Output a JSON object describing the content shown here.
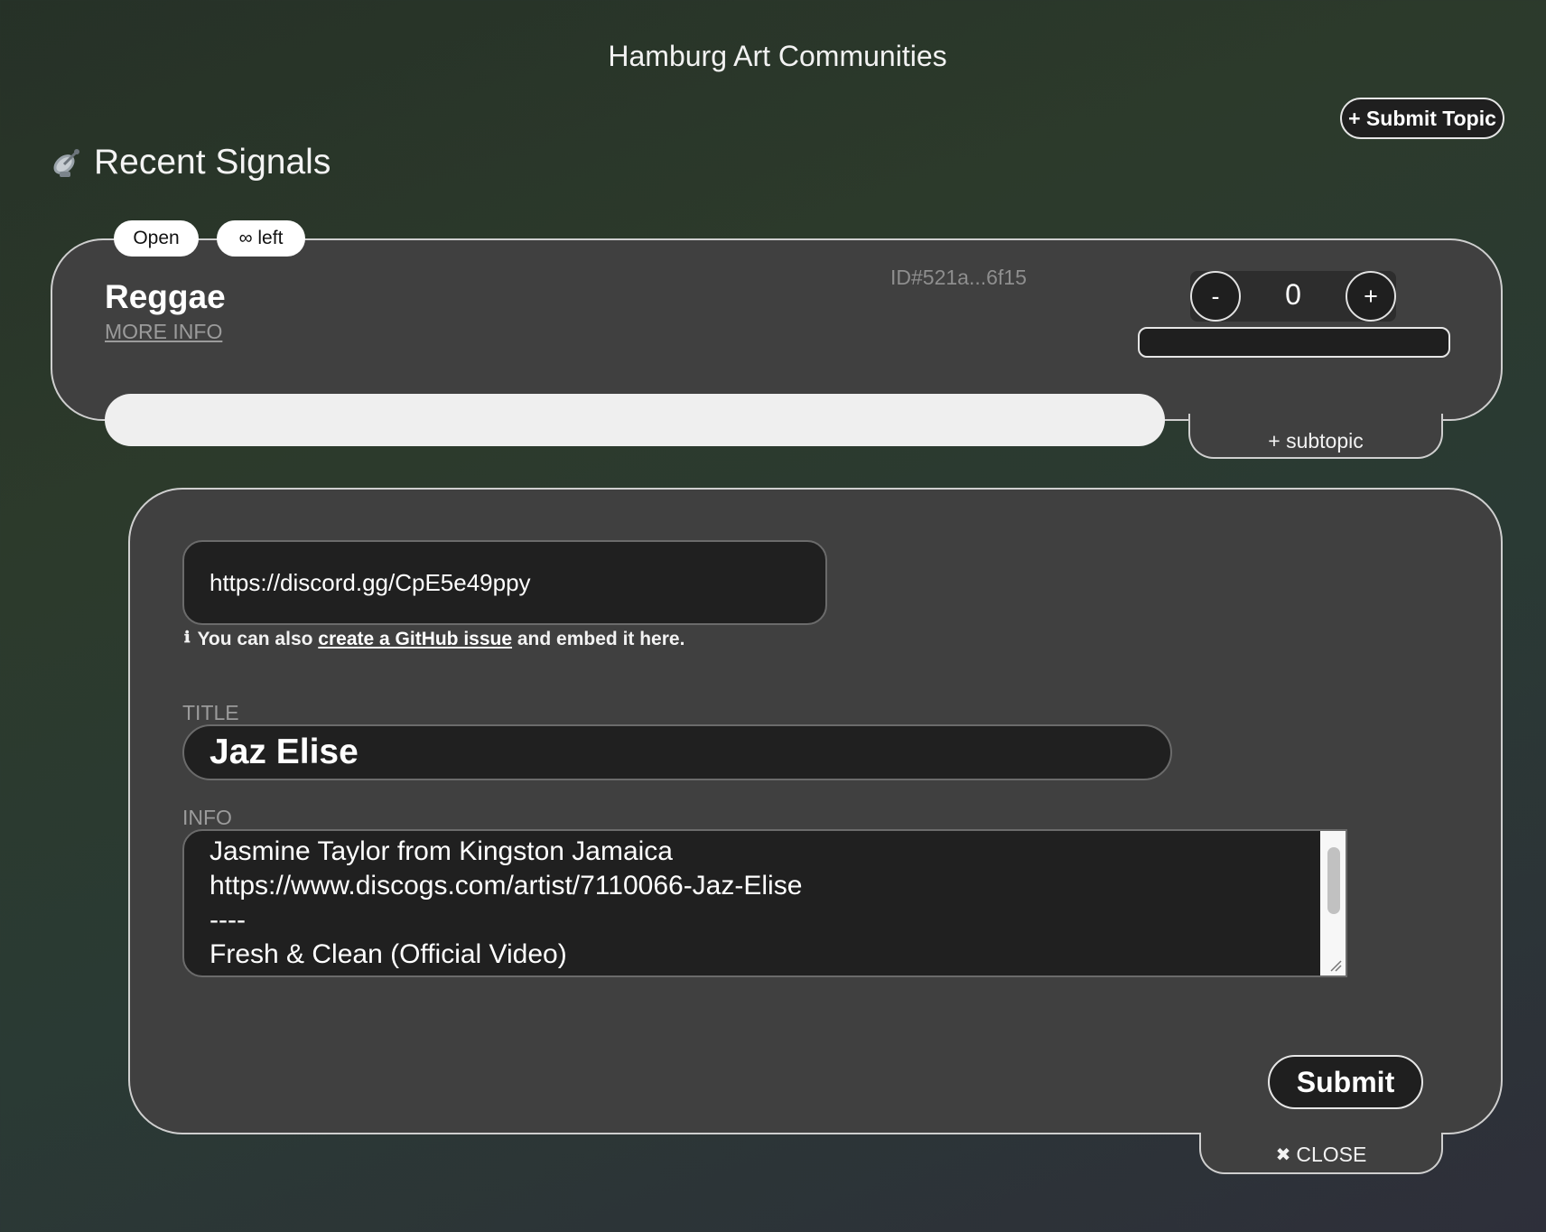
{
  "header": {
    "title": "Hamburg Art Communities",
    "submit_topic_label": "+ Submit Topic"
  },
  "section": {
    "title": "Recent Signals",
    "icon": "satellite-dish-icon"
  },
  "topic": {
    "status": "Open",
    "remaining": "∞ left",
    "name": "Reggae",
    "more_info_label": "MORE INFO",
    "id": "ID#521a...6f15",
    "vote_count": "0",
    "vote_minus_label": "-",
    "vote_plus_label": "+",
    "add_subtopic_label": "+ subtopic"
  },
  "form": {
    "url_value": "https://discord.gg/CpE5e49ppy",
    "hint_prefix": "You can also ",
    "hint_link": "create a GitHub issue",
    "hint_suffix": " and embed it here.",
    "title_label": "TITLE",
    "title_value": "Jaz Elise",
    "info_label": "INFO",
    "info_lines": [
      "Jasmine Taylor from Kingston Jamaica",
      "https://www.discogs.com/artist/7110066-Jaz-Elise",
      "----",
      "Fresh & Clean (Official Video)"
    ],
    "submit_label": "Submit",
    "close_label": "CLOSE"
  }
}
